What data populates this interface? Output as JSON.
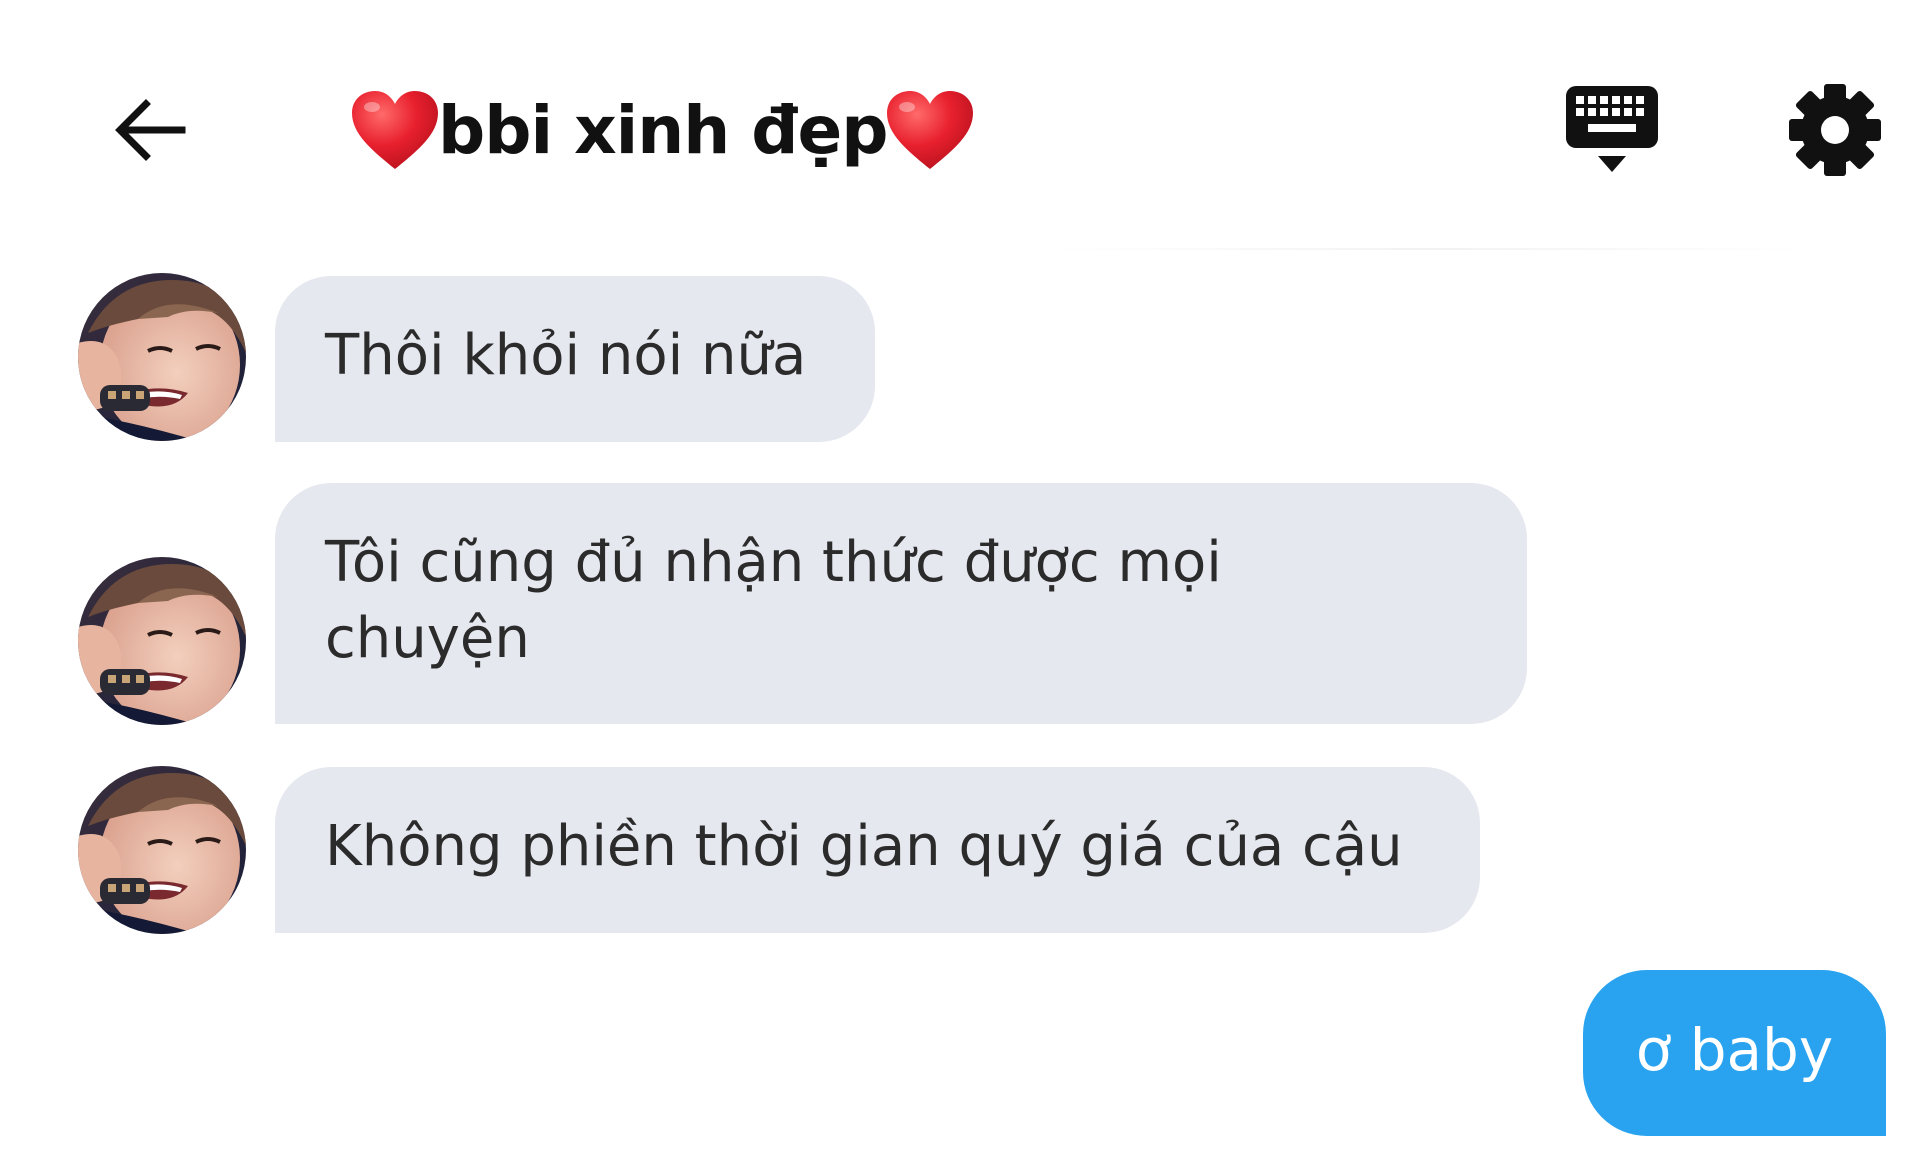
{
  "header": {
    "title": "bbi xinh đẹp",
    "icons": {
      "back": "arrow-left-icon",
      "title_left": "red-heart-emoji",
      "title_right": "red-heart-emoji",
      "keyboard": "keyboard-hide-icon",
      "settings": "gear-icon"
    }
  },
  "messages": [
    {
      "direction": "incoming",
      "text": "Thôi khỏi nói nữa"
    },
    {
      "direction": "incoming",
      "text": "Tôi cũng đủ nhận thức được mọi chuyện"
    },
    {
      "direction": "incoming",
      "text": "Không phiền thời gian quý giá của cậu"
    },
    {
      "direction": "outgoing",
      "text": "ơ baby"
    }
  ],
  "colors": {
    "incoming_bubble": "#e6e8f0",
    "outgoing_bubble": "#29a3ef",
    "outgoing_text": "#ffffff",
    "heart": "#e8202e"
  }
}
